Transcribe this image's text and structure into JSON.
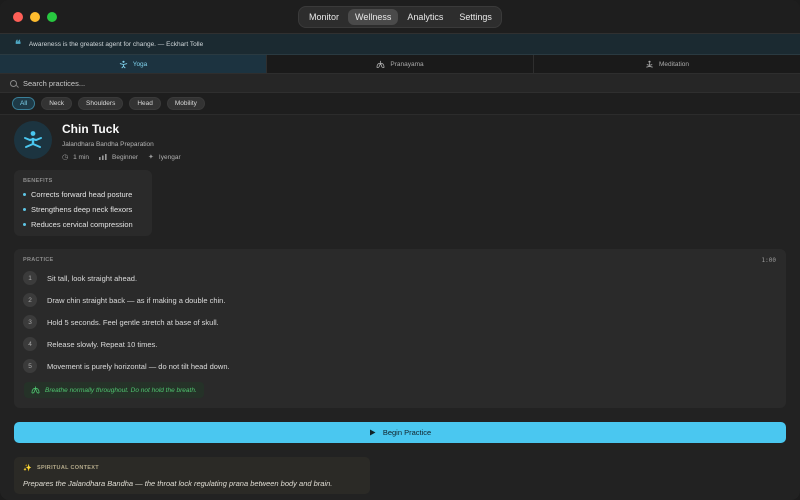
{
  "nav": {
    "segments": [
      {
        "label": "Monitor"
      },
      {
        "label": "Wellness"
      },
      {
        "label": "Analytics"
      },
      {
        "label": "Settings"
      }
    ],
    "active_segment": "Wellness"
  },
  "quote": {
    "icon": "quote-icon",
    "text": "Awareness is the greatest agent for change. — Eckhart Tolle"
  },
  "tabs": [
    {
      "label": "Yoga",
      "icon": "yoga-icon",
      "active": true
    },
    {
      "label": "Pranayama",
      "icon": "lungs-icon",
      "active": false
    },
    {
      "label": "Meditation",
      "icon": "meditation-icon",
      "active": false
    }
  ],
  "search": {
    "placeholder": "Search practices...",
    "value": ""
  },
  "filters": [
    {
      "label": "All",
      "active": true
    },
    {
      "label": "Neck",
      "active": false
    },
    {
      "label": "Shoulders",
      "active": false
    },
    {
      "label": "Head",
      "active": false
    },
    {
      "label": "Mobility",
      "active": false
    }
  ],
  "pose": {
    "title": "Chin Tuck",
    "subtitle": "Jalandhara Bandha Preparation",
    "duration": "1 min",
    "level": "Beginner",
    "style": "Iyengar"
  },
  "benefits": {
    "label": "BENEFITS",
    "items": [
      "Corrects forward head posture",
      "Strengthens deep neck flexors",
      "Reduces cervical compression"
    ]
  },
  "practice": {
    "label": "PRACTICE",
    "duration": "1:00",
    "steps": [
      {
        "num": "1",
        "text": "Sit tall, look straight ahead."
      },
      {
        "num": "2",
        "text": "Draw chin straight back — as if making a double chin."
      },
      {
        "num": "3",
        "text": "Hold 5 seconds. Feel gentle stretch at base of skull."
      },
      {
        "num": "4",
        "text": "Release slowly. Repeat 10 times."
      },
      {
        "num": "5",
        "text": "Movement is purely horizontal — do not tilt head down."
      }
    ],
    "breath_note": "Breathe normally throughout. Do not hold the breath."
  },
  "begin_button": {
    "label": "Begin Practice",
    "icon": "play-icon"
  },
  "spiritual": {
    "label": "SPIRITUAL CONTEXT",
    "text": "Prepares the Jalandhara Bandha — the throat lock regulating prana between body and brain."
  },
  "colors": {
    "accent": "#4ac7f0",
    "success": "#4fc46f",
    "background": "#222222"
  }
}
